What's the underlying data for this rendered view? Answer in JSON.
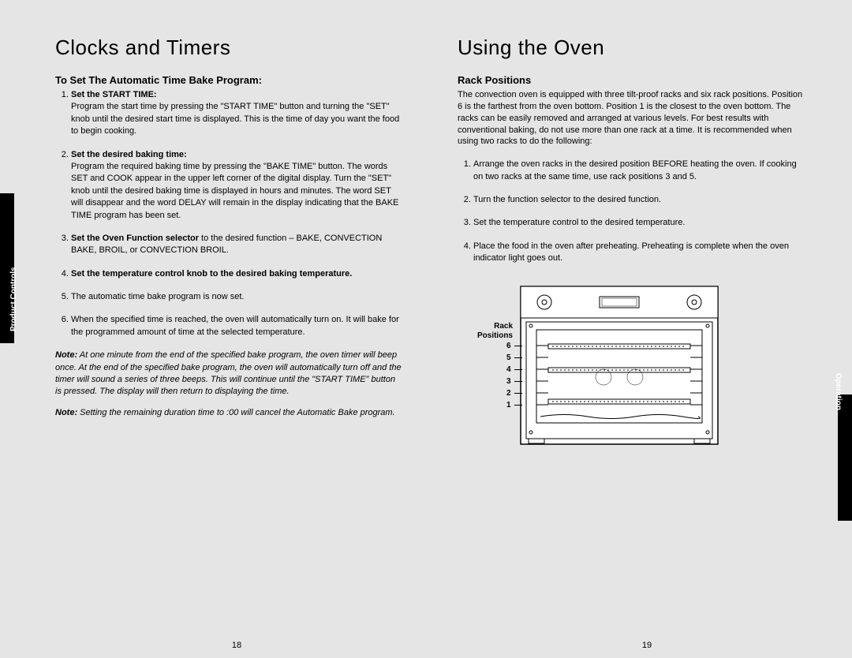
{
  "left": {
    "heading": "Clocks and Timers",
    "sub": "To Set The Automatic Time Bake Program:",
    "steps": [
      {
        "title": "Set the START TIME:",
        "body": "Program the start time by pressing the \"START TIME\" button and turning the \"SET\" knob until the desired start time is displayed. This is the time of day you want the food to begin cooking."
      },
      {
        "title": "Set the desired baking time:",
        "body": "Program the required baking time by pressing the \"BAKE TIME\" button. The words SET and COOK appear in the upper left corner of the digital display. Turn the \"SET\" knob until the desired baking time is displayed in hours and minutes. The word SET will disappear and the word DELAY will remain in the display indicating that the BAKE TIME program has been set."
      },
      {
        "title": "Set the Oven Function selector",
        "body": " to the desired function – BAKE, CONVECTION BAKE, BROIL, or CONVECTION BROIL.",
        "inline": true
      },
      {
        "title": "Set the temperature control knob to the desired baking temperature.",
        "body": ""
      },
      {
        "title": "",
        "body": "The automatic time bake program is now set."
      },
      {
        "title": "",
        "body": "When the specified time is reached, the oven will automatically turn on. It will bake for the programmed amount of time at the selected temperature."
      }
    ],
    "note1_label": "Note:",
    "note1": " At one minute from the end of the specified bake program, the oven timer will beep once. At the end of the specified bake program, the oven will automatically turn off and the timer will sound a series of three beeps. This will continue until the \"START TIME\" button is pressed. The display will then return to displaying the time.",
    "note2_label": "Note:",
    "note2": " Setting the remaining duration time to :00 will cancel the Automatic Bake program.",
    "pagenum": "18",
    "sidetab": "Product Controls"
  },
  "right": {
    "heading": "Using the Oven",
    "sub": "Rack Positions",
    "intro": "The convection oven is equipped with three tilt-proof racks and six rack positions. Position 6 is the farthest from the oven bottom. Position 1 is the closest to the oven bottom. The racks can be easily removed and arranged at various levels. For best results with conventional baking, do not use more than one rack at a time. It is recommended when using two racks to do the following:",
    "steps": [
      "Arrange the oven racks in the desired position BEFORE heating the oven. If cooking on two racks at the same time, use rack positions 3 and 5.",
      "Turn the function selector to the desired function.",
      "Set the temperature control to the desired temperature.",
      "Place the food in the oven after preheating. Preheating is complete when the oven indicator light goes out."
    ],
    "diagram_label": "Rack Positions",
    "rack_numbers": [
      "6",
      "5",
      "4",
      "3",
      "2",
      "1"
    ],
    "pagenum": "19",
    "sidetab": "Operation"
  }
}
